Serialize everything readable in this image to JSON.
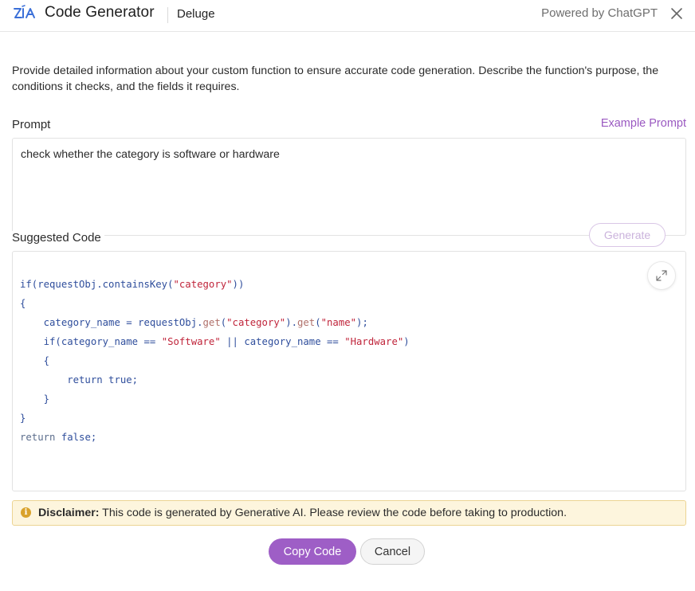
{
  "header": {
    "title": "Code Generator",
    "language": "Deluge",
    "powered_by": "Powered by ChatGPT",
    "logo_icon": "zia-logo-icon",
    "close_icon": "close-icon"
  },
  "description": "Provide detailed information about your custom function to ensure accurate code generation. Describe the function's purpose, the conditions it checks, and the fields it requires.",
  "prompt": {
    "label": "Prompt",
    "example_link": "Example Prompt",
    "value": "check whether the category is software or hardware"
  },
  "suggested": {
    "label": "Suggested Code",
    "generate_label": "Generate",
    "expand_icon": "expand-icon",
    "code_lines": [
      "if(requestObj.containsKey(\"category\"))",
      "{",
      "    category_name = requestObj.get(\"category\").get(\"name\");",
      "    if(category_name == \"Software\" || category_name == \"Hardware\")",
      "    {",
      "        return true;",
      "    }",
      "}",
      "return false;"
    ]
  },
  "disclaimer": {
    "icon": "info-icon",
    "strong": "Disclaimer:",
    "text": " This code is generated by Generative AI. Please review the code before taking to production."
  },
  "actions": {
    "copy_label": "Copy Code",
    "cancel_label": "Cancel"
  },
  "colors": {
    "accent": "#9e5ec6",
    "link": "#9a59c1",
    "warning_bg": "#fdf5dd",
    "warning_border": "#ecd493"
  }
}
